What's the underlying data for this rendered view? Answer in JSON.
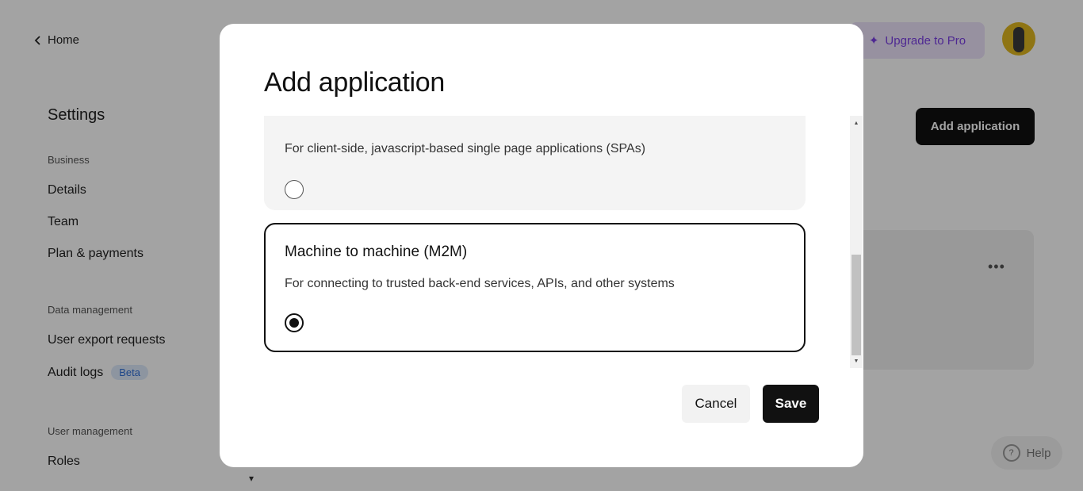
{
  "background": {
    "home_link": "Home",
    "upgrade_button": "Upgrade to Pro",
    "settings_title": "Settings",
    "sections": [
      {
        "heading": "Business",
        "items": [
          "Details",
          "Team",
          "Plan & payments"
        ]
      },
      {
        "heading": "Data management",
        "items": [
          "User export requests",
          "Audit logs"
        ]
      },
      {
        "heading": "User management",
        "items": [
          "Roles"
        ]
      }
    ],
    "audit_logs_badge": "Beta",
    "add_application_button": "Add application",
    "help_button": "Help"
  },
  "modal": {
    "title": "Add application",
    "options": [
      {
        "title": "",
        "description": "For client-side, javascript-based single page applications (SPAs)",
        "selected": false
      },
      {
        "title": "Machine to machine (M2M)",
        "description": "For connecting to trusted back-end services, APIs, and other systems",
        "selected": true
      }
    ],
    "cancel_label": "Cancel",
    "save_label": "Save"
  }
}
